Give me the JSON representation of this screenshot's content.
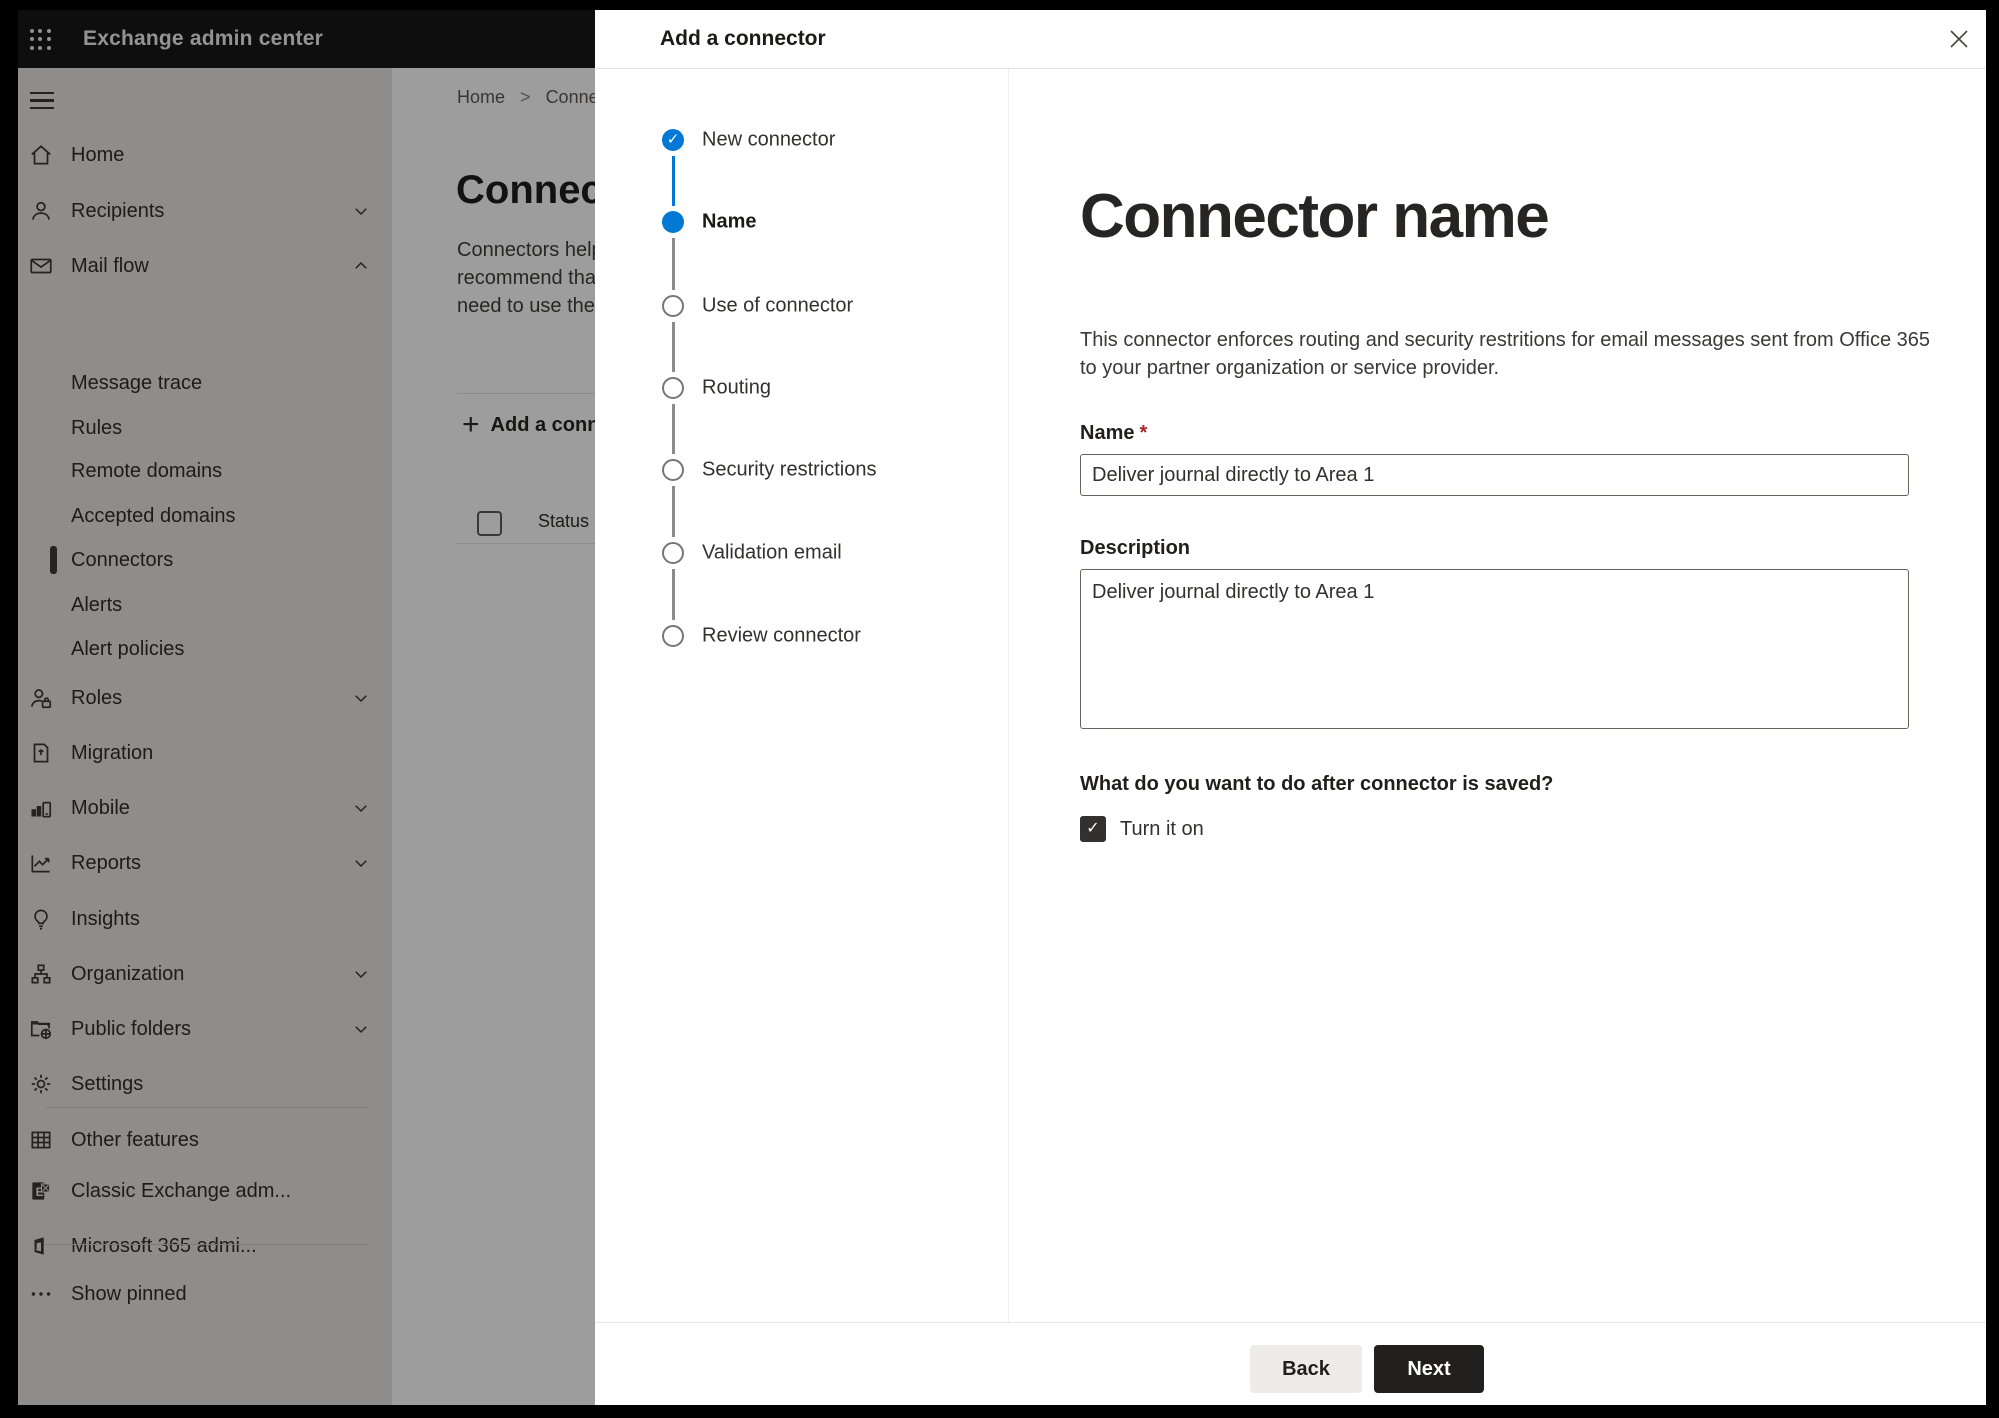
{
  "colors": {
    "accent": "#0078d4",
    "topbar_bg": "#191817",
    "primary_button_bg": "#21201f",
    "required_red": "#a4262c",
    "selected_nav_marker": "#3b3a39"
  },
  "topbar": {
    "app_title": "Exchange admin center"
  },
  "sidebar": {
    "items": [
      {
        "label": "Home"
      },
      {
        "label": "Recipients"
      },
      {
        "label": "Mail flow"
      },
      {
        "label": "Message trace"
      },
      {
        "label": "Rules"
      },
      {
        "label": "Remote domains"
      },
      {
        "label": "Accepted domains"
      },
      {
        "label": "Connectors"
      },
      {
        "label": "Alerts"
      },
      {
        "label": "Alert policies"
      },
      {
        "label": "Roles"
      },
      {
        "label": "Migration"
      },
      {
        "label": "Mobile"
      },
      {
        "label": "Reports"
      },
      {
        "label": "Insights"
      },
      {
        "label": "Organization"
      },
      {
        "label": "Public folders"
      },
      {
        "label": "Settings"
      },
      {
        "label": "Other features"
      },
      {
        "label": "Classic Exchange adm..."
      },
      {
        "label": "Microsoft 365 admi..."
      },
      {
        "label": "Show pinned"
      }
    ]
  },
  "page": {
    "breadcrumb": {
      "home": "Home",
      "separator": ">",
      "current": "Conne"
    },
    "title": "Connect",
    "para_line1": "Connectors help co",
    "para_line2": "recommend that yo",
    "para_line3": "need to use them b",
    "add_button_plus": "+",
    "add_button_label": "Add a conne",
    "table_header_status": "Status"
  },
  "dialog": {
    "title": "Add a connector",
    "close_icon": "close",
    "steps": [
      {
        "label": "New connector",
        "state": "done"
      },
      {
        "label": "Name",
        "state": "current"
      },
      {
        "label": "Use of connector",
        "state": "todo"
      },
      {
        "label": "Routing",
        "state": "todo"
      },
      {
        "label": "Security restrictions",
        "state": "todo"
      },
      {
        "label": "Validation email",
        "state": "todo"
      },
      {
        "label": "Review connector",
        "state": "todo"
      }
    ],
    "done_check_glyph": "✓",
    "heading": "Connector name",
    "body_line1": "This connector enforces routing and security restritions for email messages sent from Office 365",
    "body_line2": "to your partner organization or service provider.",
    "name_label": "Name",
    "name_required_mark": "*",
    "name_value": "Deliver journal directly to Area 1",
    "description_label": "Description",
    "description_value": "Deliver journal directly to Area 1",
    "after_save_question": "What do you want to do after connector is saved?",
    "turn_on_label": "Turn it on",
    "turn_on_checked": true,
    "turn_on_check_glyph": "✓",
    "back_label": "Back",
    "next_label": "Next"
  }
}
